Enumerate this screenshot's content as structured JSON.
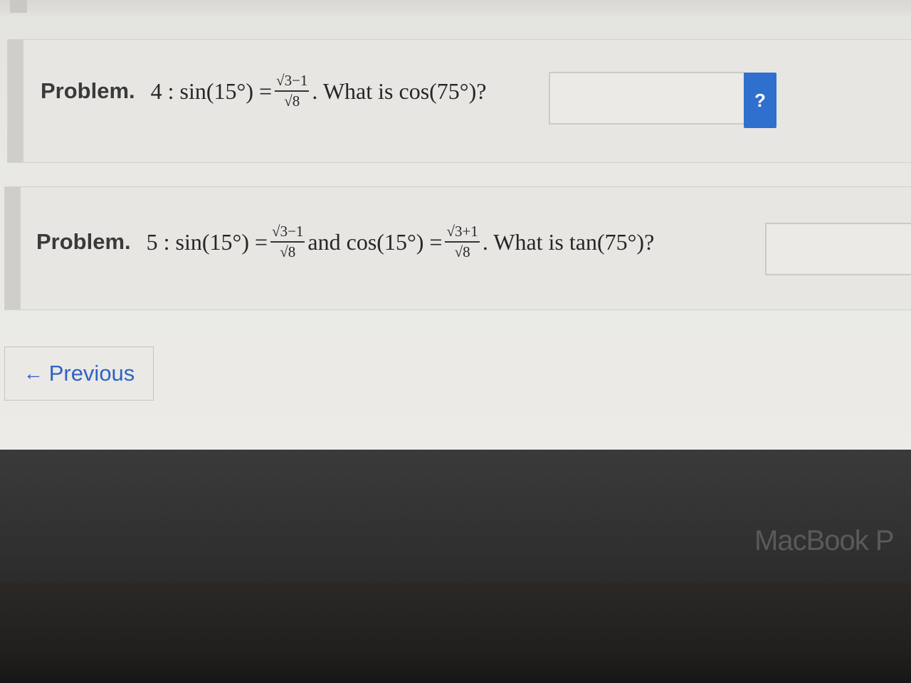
{
  "problems": [
    {
      "label": "Problem.",
      "pre": "4 : sin(15°) =",
      "frac": {
        "num": "√3−1",
        "den": "√8"
      },
      "post": ". What is cos(75°)?",
      "help_label": "?"
    },
    {
      "label": "Problem.",
      "pre": "5 : sin(15°) =",
      "frac": {
        "num": "√3−1",
        "den": "√8"
      },
      "mid": "and cos(15°) =",
      "frac2": {
        "num": "√3+1",
        "den": "√8"
      },
      "post": ". What is tan(75°)?"
    }
  ],
  "nav": {
    "prev_arrow": "←",
    "prev_label": "Previous"
  },
  "device": {
    "brand": "MacBook P"
  },
  "colors": {
    "accent": "#2f6fcd",
    "link": "#2f62c4"
  }
}
